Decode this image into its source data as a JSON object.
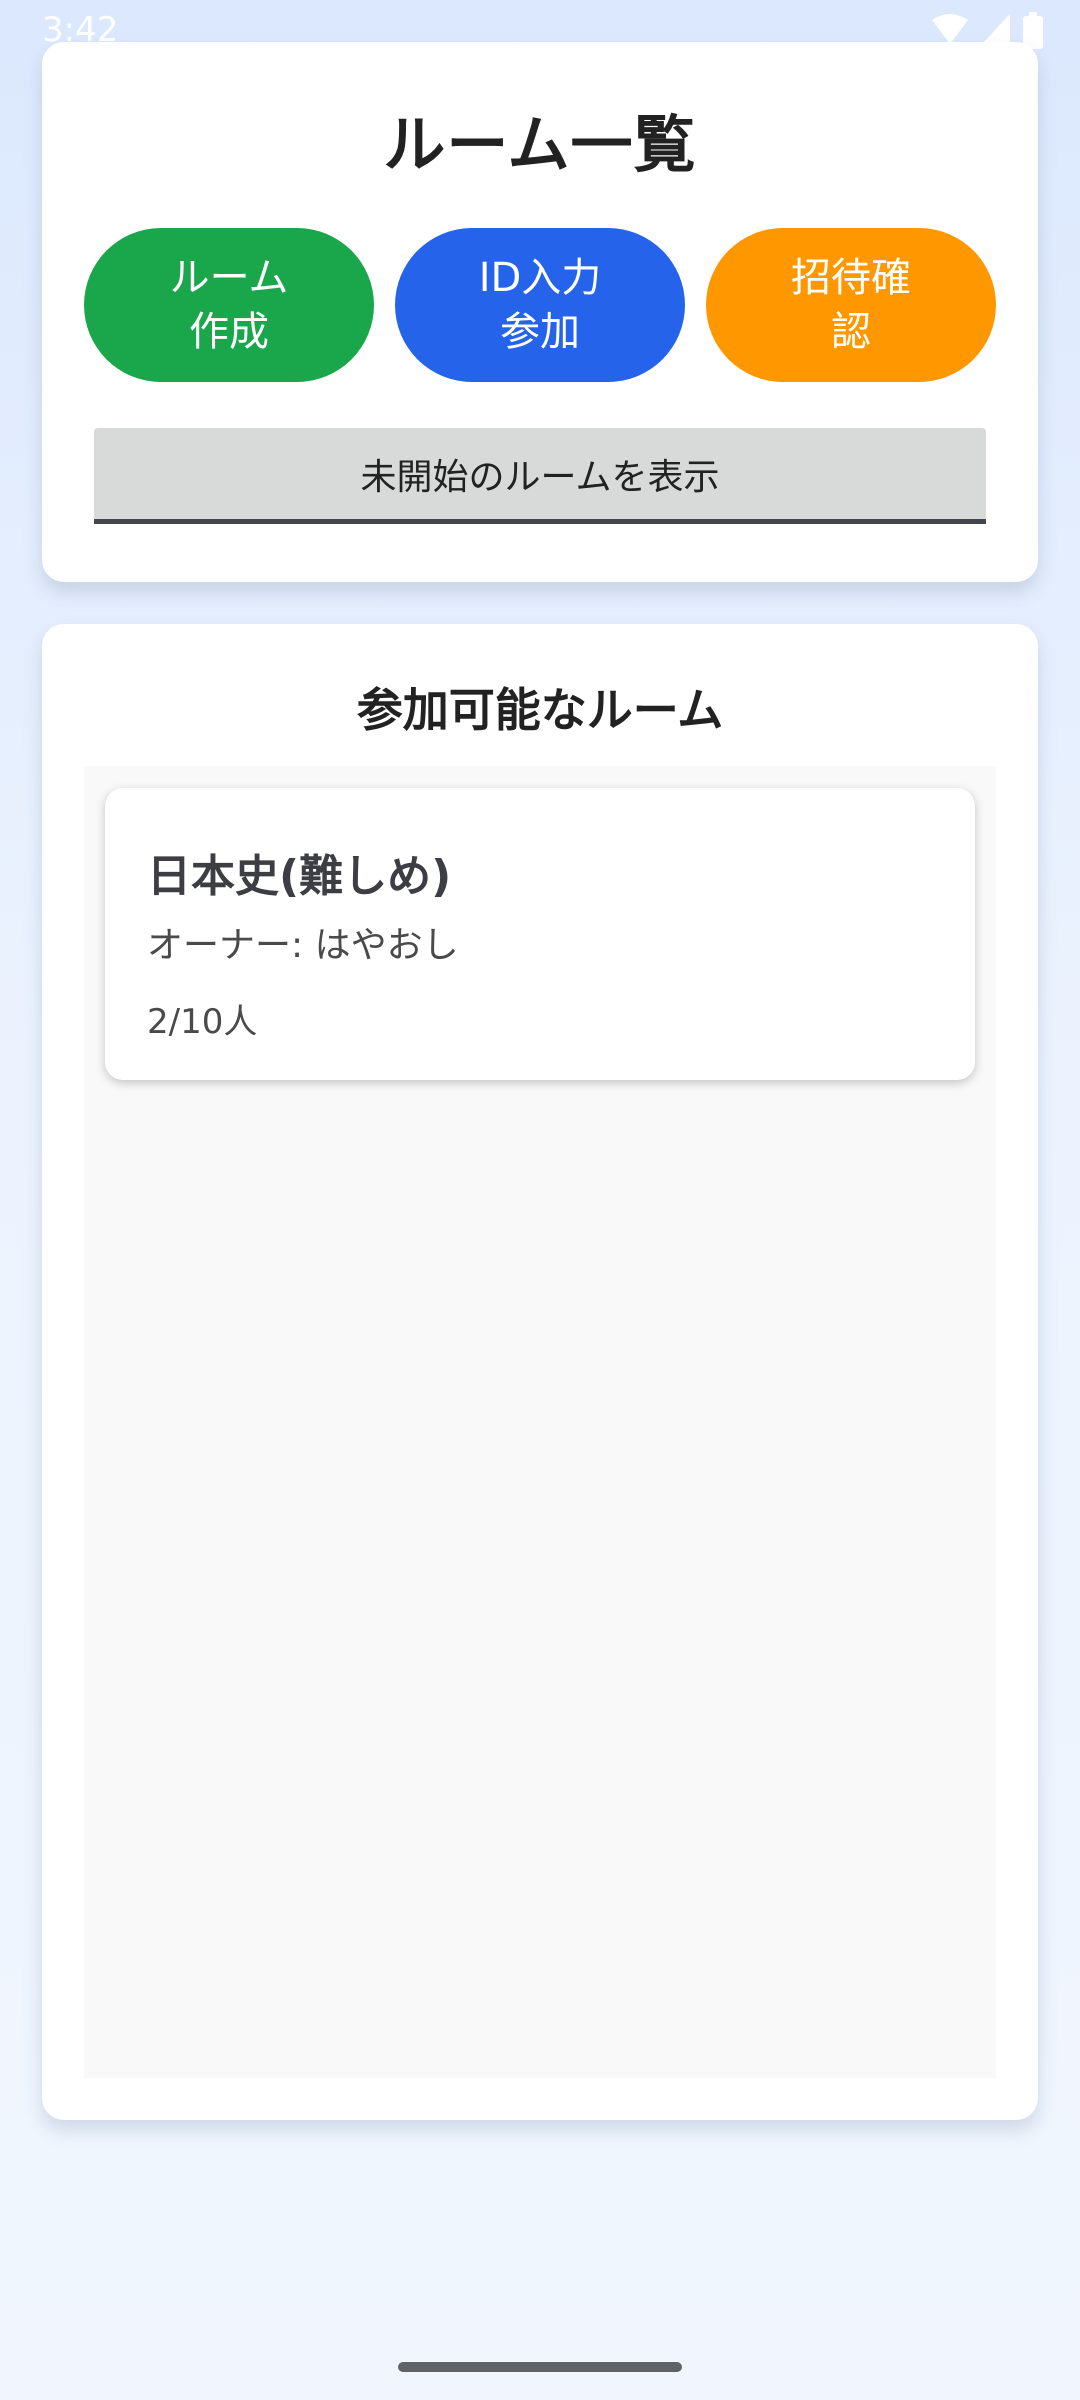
{
  "status_bar": {
    "time": "3:42",
    "icons": [
      "wifi-icon",
      "signal-icon",
      "battery-icon"
    ],
    "color": "#ffffff"
  },
  "header": {
    "title": "ルーム一覧"
  },
  "actions": {
    "create_label": "ルーム\n作成",
    "join_by_id_label": "ID入力\n参加",
    "invitations_label": "招待確\n認",
    "colors": {
      "create": "#1aa64b",
      "join_by_id": "#2563eb",
      "invitations": "#ff9700"
    }
  },
  "filter": {
    "toggle_label": "未開始のルームを表示"
  },
  "rooms_section": {
    "title": "参加可能なルーム",
    "rooms": [
      {
        "name": "日本史(難しめ)",
        "owner": "オーナー: はやおし",
        "members": "2/10人"
      }
    ]
  }
}
